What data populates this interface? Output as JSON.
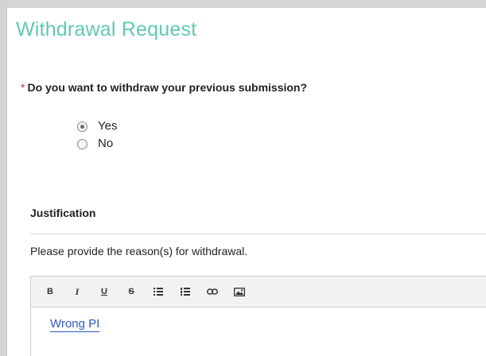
{
  "form": {
    "title": "Withdrawal Request",
    "required_mark": "*",
    "question": "Do you want to withdraw your previous submission?",
    "options": [
      {
        "label": "Yes",
        "selected": true
      },
      {
        "label": "No",
        "selected": false
      }
    ]
  },
  "justification": {
    "title": "Justification",
    "helper": "Please provide the reason(s) for withdrawal.",
    "toolbar": {
      "bold": "B",
      "italic": "I",
      "underline": "U",
      "strike": "S",
      "icons": [
        "bold-icon",
        "italic-icon",
        "underline-icon",
        "strikethrough-icon",
        "bulleted-list-icon",
        "numbered-list-icon",
        "link-icon",
        "image-icon"
      ]
    },
    "value": "Wrong PI"
  },
  "colors": {
    "title": "#5fc9b1",
    "required": "#d9302c",
    "link_text": "#2b56c9",
    "page_background": "#d4d4d4"
  }
}
